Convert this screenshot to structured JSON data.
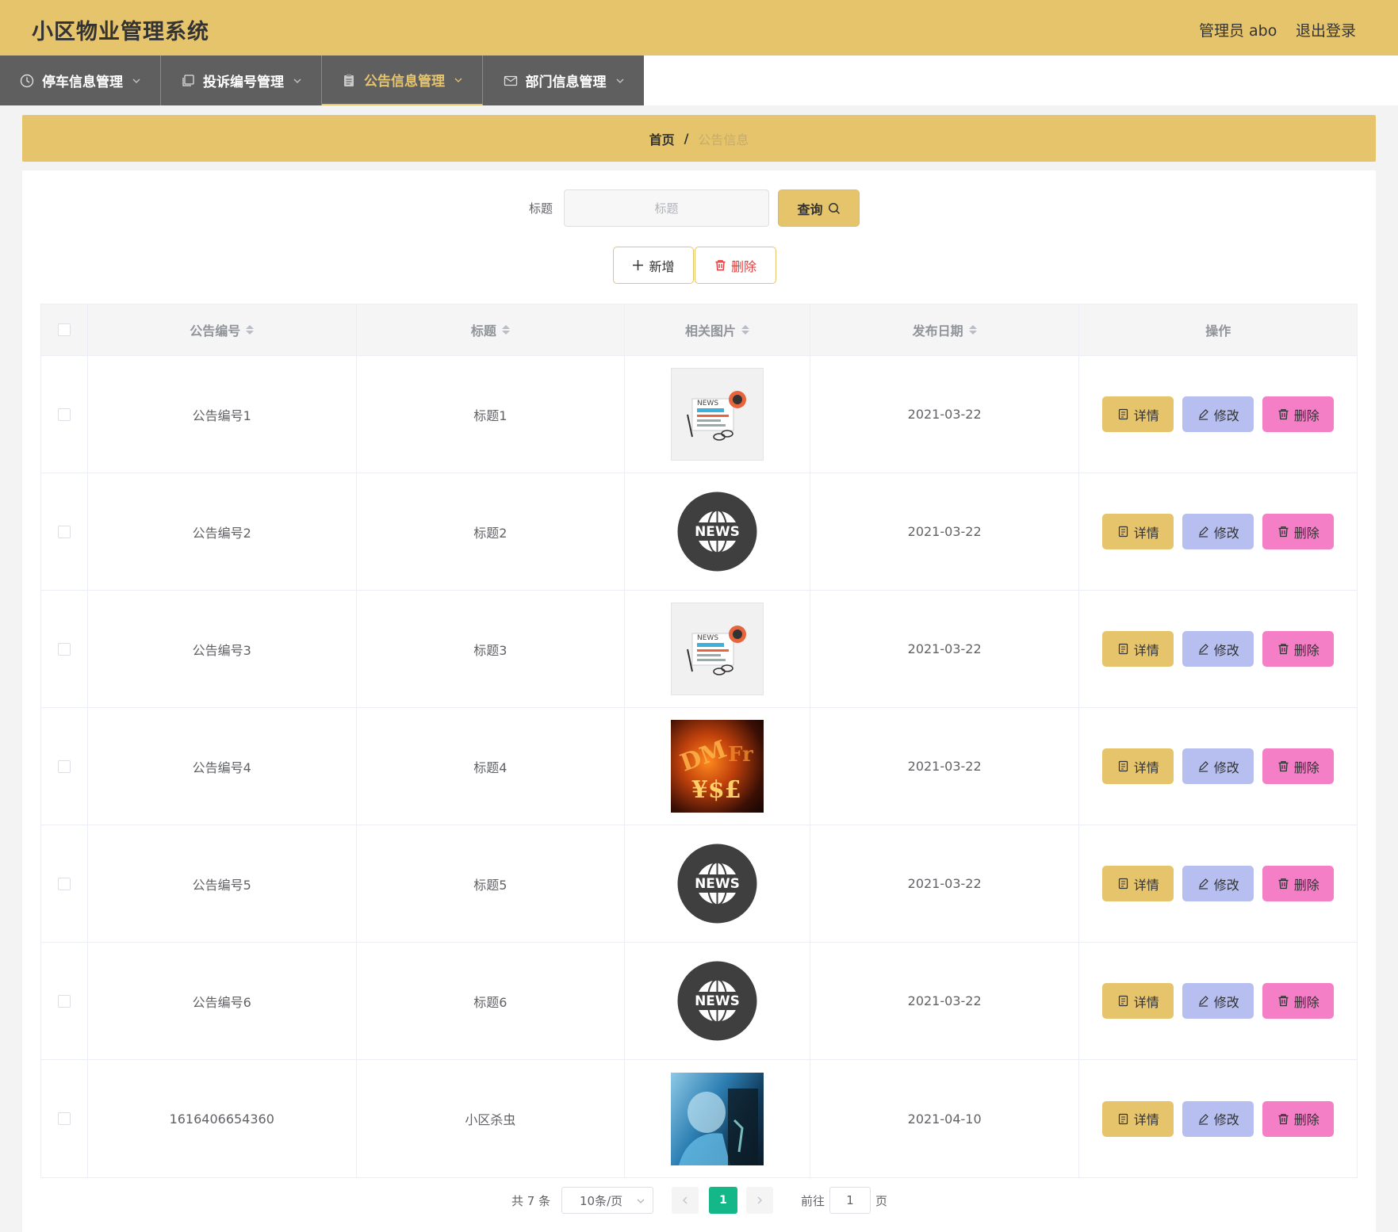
{
  "app": {
    "title": "小区物业管理系统",
    "user": "管理员 abo",
    "logout": "退出登录"
  },
  "nav": [
    {
      "label": "停车信息管理",
      "icon": "clock-icon"
    },
    {
      "label": "投诉编号管理",
      "icon": "copy-icon"
    },
    {
      "label": "公告信息管理",
      "icon": "clipboard-icon",
      "active": true
    },
    {
      "label": "部门信息管理",
      "icon": "mail-icon"
    }
  ],
  "breadcrumb": {
    "home": "首页",
    "separator": "/",
    "current": "公告信息"
  },
  "search": {
    "label": "标题",
    "placeholder": "标题",
    "value": "",
    "button": "查询"
  },
  "actions": {
    "add": "新增",
    "delete": "删除"
  },
  "table": {
    "headers": [
      "公告编号",
      "标题",
      "相关图片",
      "发布日期",
      "操作"
    ],
    "rows": [
      {
        "code": "公告编号1",
        "title": "标题1",
        "image": "news-paper",
        "date": "2021-03-22"
      },
      {
        "code": "公告编号2",
        "title": "标题2",
        "image": "news-globe",
        "date": "2021-03-22"
      },
      {
        "code": "公告编号3",
        "title": "标题3",
        "image": "news-paper",
        "date": "2021-03-22"
      },
      {
        "code": "公告编号4",
        "title": "标题4",
        "image": "currency-fire",
        "date": "2021-03-22"
      },
      {
        "code": "公告编号5",
        "title": "标题5",
        "image": "news-globe",
        "date": "2021-03-22"
      },
      {
        "code": "公告编号6",
        "title": "标题6",
        "image": "news-globe",
        "date": "2021-03-22"
      },
      {
        "code": "1616406654360",
        "title": "小区杀虫",
        "image": "lab-worker",
        "date": "2021-04-10"
      }
    ],
    "row_actions": {
      "detail": "详情",
      "edit": "修改",
      "delete": "删除"
    }
  },
  "pagination": {
    "total": "共 7 条",
    "page_size": "10条/页",
    "current": "1",
    "goto": "前往",
    "goto_value": "1",
    "page_unit": "页"
  },
  "colors": {
    "primary": "#e6c46c",
    "nav_bg": "#5f5f5f",
    "edit": "#b7bff0",
    "delete": "#f57fc6",
    "pager_active": "#13b788"
  }
}
